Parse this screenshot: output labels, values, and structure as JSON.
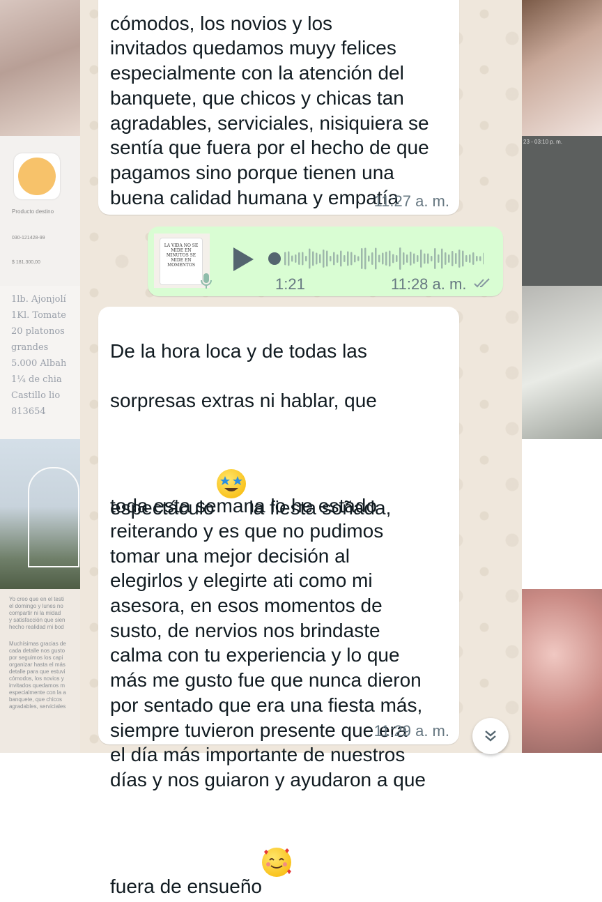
{
  "messages": [
    {
      "id": "m1",
      "direction": "incoming",
      "text_partial_top": "cómodos, los novios y los",
      "text": "invitados quedamos muyy felices\nespecialmente con la atención del\nbanquete, que chicos y chicas tan\nagradables, serviciales, nisiquiera se\nsentía que fuera por el hecho de que\npagamos sino porque tienen una\nbuena calidad humana y empatía",
      "time": "11:27 a. m."
    },
    {
      "id": "m2",
      "direction": "outgoing",
      "type": "voice",
      "thumbnail_text": "LA VIDA NO SE MIDE EN MINUTOS SE MIDE EN MOMENTOS",
      "duration": "1:21",
      "time": "11:28 a. m.",
      "status_icon": "double-check-icon"
    },
    {
      "id": "m3",
      "direction": "incoming",
      "line1": "De la hora loca y de todas las",
      "line2": "sorpresas extras ni hablar, que",
      "line3_before": "espectáculo",
      "line3_emoji": "star-struck-emoji",
      "line3_after": "la fiesta soñada,",
      "body": "toda esta semana lo he estado\nreiterando y es que no pudimos\ntomar una mejor decisión al\nelegirlos y elegirte ati como mi\nasesora, en esos momentos de\nsusto, de nervios nos brindaste\ncalma con tu experiencia y lo que\nmás me gusto fue que nunca dieron\npor sentado que era una fiesta más,\nsiempre tuvieron presente que era\nel día más importante de nuestros\ndías y nos guiaron y ayudaron a que",
      "last_before": "fuera de ensueño",
      "last_emoji": "smiling-face-with-hearts-emoji",
      "time": "11:29 a. m."
    }
  ],
  "background": {
    "left_tiles": [
      {
        "label": "Producto destino",
        "account": "030-121428-99",
        "amount": "$ 181.300,00"
      },
      {
        "handwritten": [
          "1lb. Ajonjolí",
          "1Kl. Tomate",
          "20 platonos",
          "grandes",
          "5.000 Albah",
          "1¼ de chia",
          "Castillo lio",
          "813654"
        ]
      },
      {
        "text": [
          "Yo creo que en el testi",
          "el domingo y lunes no",
          "compartir ni la midad",
          "y satisfacción que sien",
          "hecho realidad mi bod",
          "Muchísimas gracias de",
          "cada detalle nos gusto",
          "por seguimos los capi",
          "organizar hasta el más",
          "detalle para que estuvi",
          "cómodos, los novios y",
          "invitados quedamos m",
          "especialmente con la a",
          "banquete, que chicos",
          "agradables, serviciales"
        ]
      }
    ],
    "right_tiles": [
      {
        "text": "23 - 03:10 p. m."
      }
    ]
  },
  "colors": {
    "chat_bg": "#efe7dc",
    "incoming_bubble": "#ffffff",
    "outgoing_bubble": "#d9fdd3",
    "time_text": "#667781",
    "play_icon": "#54656f"
  },
  "scroll_button_icon": "double-chevron-down-icon"
}
